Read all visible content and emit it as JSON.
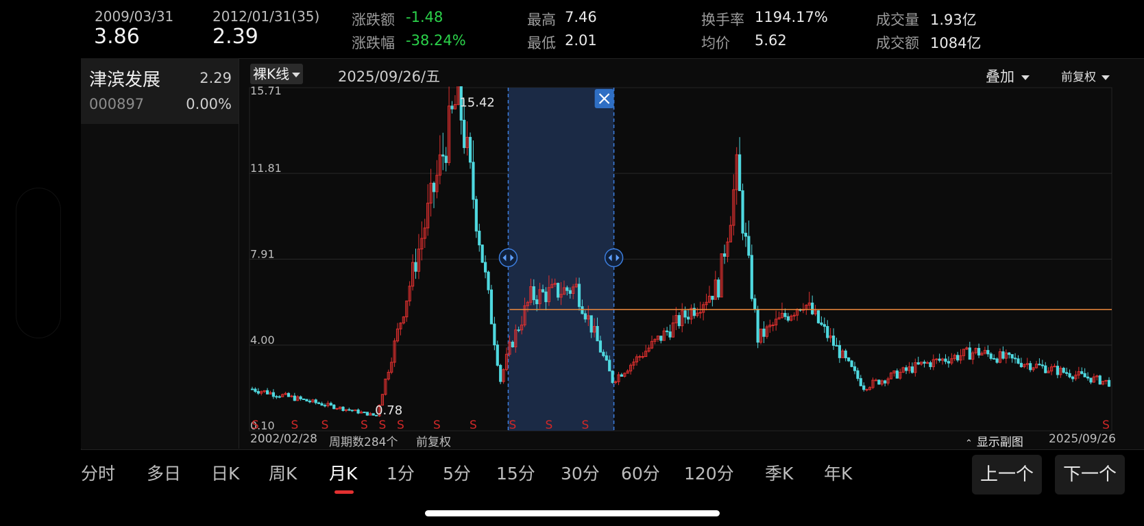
{
  "header": {
    "start_date": "2009/03/31",
    "start_price": "3.86",
    "end_date": "2012/01/31(35)",
    "end_price": "2.39",
    "change_label": "涨跌额",
    "change_value": "-1.48",
    "change_pct_label": "涨跌幅",
    "change_pct_value": "-38.24%",
    "high_label": "最高",
    "high_value": "7.46",
    "low_label": "最低",
    "low_value": "2.01",
    "turnover_rate_label": "换手率",
    "turnover_rate_value": "1194.17%",
    "avg_price_label": "均价",
    "avg_price_value": "5.62",
    "volume_label": "成交量",
    "volume_value": "1.93亿",
    "amount_label": "成交额",
    "amount_value": "1084亿"
  },
  "stock": {
    "name": "津滨发展",
    "price": "2.29",
    "code": "000897",
    "change_pct": "0.00%"
  },
  "chart_toolbar": {
    "ktype_label": "裸K线",
    "current_date": "2025/09/26/五",
    "overlay_label": "叠加",
    "adjust_label": "前复权"
  },
  "chart_footer": {
    "start_date": "2002/02/28",
    "period_count": "周期数284个",
    "adjust": "前复权",
    "show_sub_chart": "显示副图",
    "end_date": "2025/09/26"
  },
  "tabs": [
    "分时",
    "多日",
    "日K",
    "周K",
    "月K",
    "1分",
    "5分",
    "15分",
    "30分",
    "60分",
    "120分",
    "季K",
    "年K"
  ],
  "active_tab": "月K",
  "nav": {
    "prev": "上一个",
    "next": "下一个"
  },
  "colors": {
    "up": "#e0302f",
    "down": "#4fd8df",
    "ref_line": "#f08a3c",
    "selection": "#1b2a45",
    "selection_border": "#3d7fe0"
  },
  "chart_data": {
    "type": "candlestick",
    "y_ticks": [
      "15.71",
      "11.81",
      "7.91",
      "4.00",
      "0.10"
    ],
    "ylim": [
      0.1,
      15.71
    ],
    "max_label": "15.42",
    "min_label": "0.78",
    "reference_line": 5.62,
    "selection_range": [
      "2009/03/31",
      "2012/01/31"
    ],
    "signal_markers": [
      "S",
      "S",
      "S",
      "S",
      "S",
      "S",
      "S",
      "S",
      "S",
      "S",
      "S",
      "S"
    ],
    "key_points": [
      {
        "date": "2002/02",
        "price": 2.0
      },
      {
        "date": "2005/07",
        "price": 0.78
      },
      {
        "date": "2007/10",
        "price": 15.42
      },
      {
        "date": "2008/12",
        "price": 2.4
      },
      {
        "date": "2009/03",
        "price": 3.86
      },
      {
        "date": "2009/10",
        "price": 6.2
      },
      {
        "date": "2011/01",
        "price": 6.6
      },
      {
        "date": "2012/01",
        "price": 2.39
      },
      {
        "date": "2014/12",
        "price": 6.7
      },
      {
        "date": "2015/06",
        "price": 11.81
      },
      {
        "date": "2016/01",
        "price": 4.3
      },
      {
        "date": "2017/04",
        "price": 6.0
      },
      {
        "date": "2018/12",
        "price": 2.1
      },
      {
        "date": "2020/07",
        "price": 3.1
      },
      {
        "date": "2022/01",
        "price": 3.7
      },
      {
        "date": "2025/09",
        "price": 2.29
      }
    ]
  }
}
